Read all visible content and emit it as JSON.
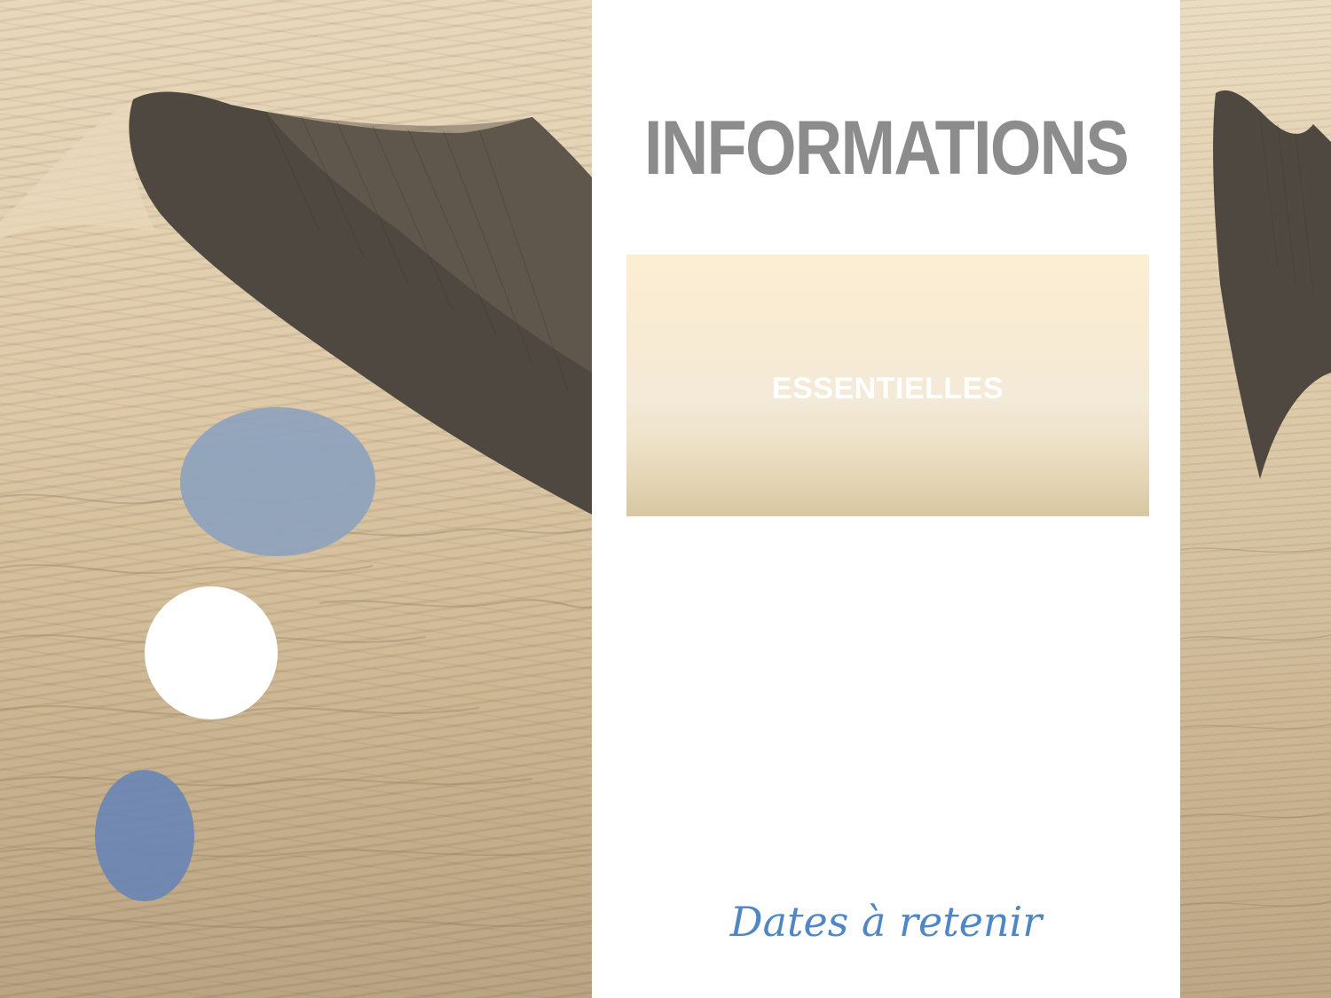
{
  "header": {
    "title": "INFORMATIONS"
  },
  "banner": {
    "label": "ESSENTIELLES"
  },
  "footer": {
    "text": "Dates à retenir"
  },
  "colors": {
    "title": "#8c8c8c",
    "banner_text": "#ffffff",
    "footer_text": "#4f86c6",
    "circle_blue": "#8fa3bd",
    "circle_blue_dark": "#6a86b4"
  }
}
